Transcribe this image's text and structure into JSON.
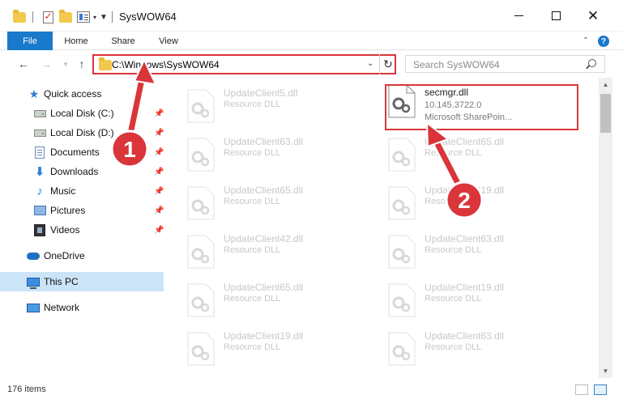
{
  "window": {
    "title": "SysWOW64"
  },
  "ribbon": {
    "tabs": [
      "File",
      "Home",
      "Share",
      "View"
    ],
    "help": "?"
  },
  "address": {
    "path": "C:\\Windows\\SysWOW64",
    "search_placeholder": "Search SysWOW64"
  },
  "sidebar": {
    "items": [
      {
        "label": "Quick access",
        "icon": "star-icon",
        "pinned": false
      },
      {
        "label": "Local Disk (C:)",
        "icon": "local-disk-icon",
        "pinned": true
      },
      {
        "label": "Local Disk (D:)",
        "icon": "local-disk-icon",
        "pinned": true
      },
      {
        "label": "Documents",
        "icon": "documents-icon",
        "pinned": true
      },
      {
        "label": "Downloads",
        "icon": "downloads-icon",
        "pinned": true
      },
      {
        "label": "Music",
        "icon": "music-icon",
        "pinned": true
      },
      {
        "label": "Pictures",
        "icon": "pictures-icon",
        "pinned": true
      },
      {
        "label": "Videos",
        "icon": "videos-icon",
        "pinned": true
      },
      {
        "label": "OneDrive",
        "icon": "onedrive-icon",
        "pinned": false
      },
      {
        "label": "This PC",
        "icon": "this-pc-icon",
        "pinned": false,
        "selected": true
      },
      {
        "label": "Network",
        "icon": "network-icon",
        "pinned": false
      }
    ]
  },
  "files": {
    "left": [
      {
        "name": "UpdateClient5.dll",
        "type": "Resource DLL"
      },
      {
        "name": "UpdateClient63.dll",
        "type": "Resource DLL"
      },
      {
        "name": "UpdateClient65.dll",
        "type": "Resource DLL"
      },
      {
        "name": "UpdateClient42.dll",
        "type": "Resource DLL"
      },
      {
        "name": "UpdateClient65.dll",
        "type": "Resource DLL"
      },
      {
        "name": "UpdateClient19.dll",
        "type": "Resource DLL"
      }
    ],
    "right": [
      {
        "name": "secmgr.dll",
        "type": "10.145.3722.0",
        "extra": "Microsoft SharePoin...",
        "highlighted": true
      },
      {
        "name": "UpdateClient65.dll",
        "type": "Resource DLL"
      },
      {
        "name": "UpdateClient19.dll",
        "type": "Resource DLL"
      },
      {
        "name": "UpdateClient63.dll",
        "type": "Resource DLL"
      },
      {
        "name": "UpdateClient19.dll",
        "type": "Resource DLL"
      },
      {
        "name": "UpdateClient63.dll",
        "type": "Resource DLL"
      }
    ]
  },
  "status": {
    "item_count": "176 items"
  },
  "annotations": {
    "step1": "1",
    "step2": "2",
    "color": "#d9353a"
  }
}
